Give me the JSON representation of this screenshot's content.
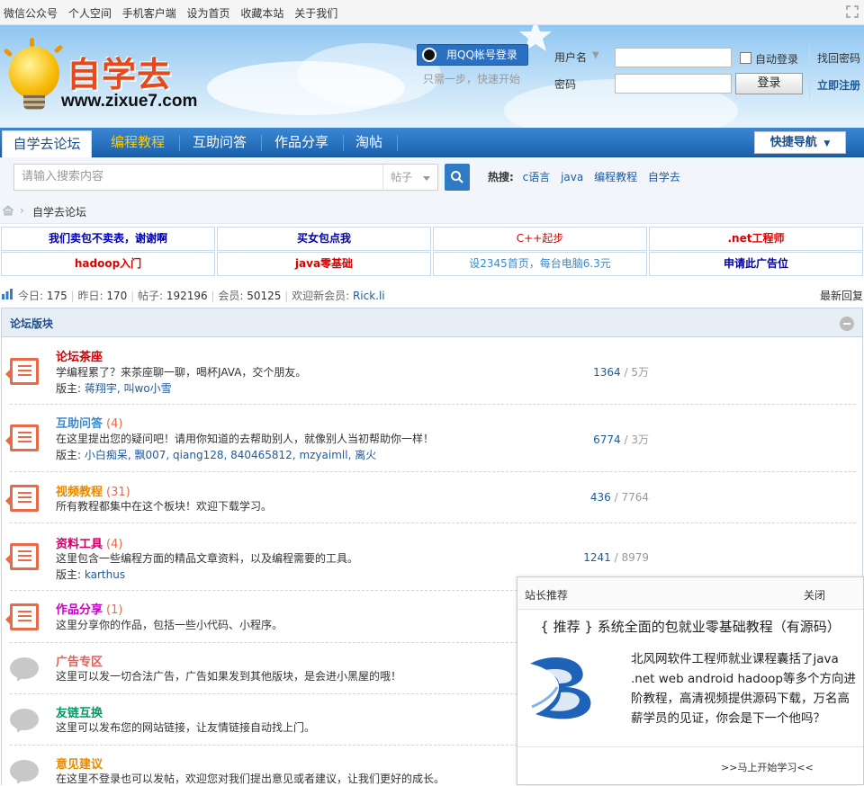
{
  "topbar": {
    "links": [
      "微信公众号",
      "个人空间",
      "手机客户端",
      "设为首页",
      "收藏本站",
      "关于我们"
    ]
  },
  "logo": {
    "name": "自学去",
    "url": "www.zixue7.com"
  },
  "login": {
    "qq_button": "用QQ帐号登录",
    "qq_tip": "只需一步，快速开始",
    "username_label": "用户名",
    "password_label": "密码",
    "auto_login": "自动登录",
    "login_button": "登录",
    "find_password": "找回密码",
    "register": "立即注册"
  },
  "nav": {
    "items": [
      "自学去论坛",
      "编程教程",
      "互助问答",
      "作品分享",
      "淘帖"
    ],
    "quick_nav": "快捷导航"
  },
  "search": {
    "placeholder": "请输入搜索内容",
    "type": "帖子",
    "hot_label": "热搜:",
    "hot_terms": [
      "c语言",
      "java",
      "编程教程",
      "自学去"
    ]
  },
  "breadcrumb": {
    "current": "自学去论坛"
  },
  "ads": [
    {
      "text": "我们卖包不卖表，谢谢啊",
      "color": "#0000aa"
    },
    {
      "text": "买女包点我",
      "color": "#0000aa"
    },
    {
      "text": "C++起步",
      "color": "#dd0000"
    },
    {
      "text": ".net工程师",
      "color": "#dd0000"
    },
    {
      "text": "hadoop入门",
      "color": "#dd0000"
    },
    {
      "text": "java零基础",
      "color": "#dd0000"
    },
    {
      "text": "设2345首页，每台电脑6.3元",
      "color": "#3a8ad0"
    },
    {
      "text": "申请此广告位",
      "color": "#0000aa"
    }
  ],
  "stats": {
    "today_label": "今日:",
    "today": "175",
    "yesterday_label": "昨日:",
    "yesterday": "170",
    "posts_label": "帖子:",
    "posts": "192196",
    "members_label": "会员:",
    "members": "50125",
    "new_member_label": "欢迎新会员:",
    "new_member": "Rick.li",
    "latest_reply": "最新回复"
  },
  "forum": {
    "section_title": "论坛版块",
    "boards": [
      {
        "title": "论坛茶座",
        "count": "",
        "color": "#cc0000",
        "desc": "学编程累了？来茶座聊一聊，喝杯JAVA，交个朋友。",
        "mods_label": "版主:",
        "mods": "蒋翔宇, 叫wo小雪",
        "threads": "1364",
        "posts": "/ 5万",
        "icon": "post-icon"
      },
      {
        "title": "互助问答",
        "count": "(4)",
        "color": "#3a8ad0",
        "desc": "在这里提出您的疑问吧！请用你知道的去帮助别人，就像别人当初帮助你一样！",
        "mods_label": "版主:",
        "mods": "小白痴呆, 飘007, qiang128, 840465812, mzyaimll, 离火",
        "threads": "6774",
        "posts": "/ 3万",
        "icon": "post-icon"
      },
      {
        "title": "视频教程",
        "count": "(31)",
        "color": "#e68a00",
        "desc": "所有教程都集中在这个板块！欢迎下载学习。",
        "mods_label": "",
        "mods": "",
        "threads": "436",
        "posts": "/ 7764",
        "icon": "post-icon"
      },
      {
        "title": "资料工具",
        "count": "(4)",
        "color": "#cc0066",
        "desc": "这里包含一些编程方面的精品文章资料，以及编程需要的工具。",
        "mods_label": "版主:",
        "mods": "karthus",
        "threads": "1241",
        "posts": "/ 8979",
        "icon": "post-icon"
      },
      {
        "title": "作品分享",
        "count": "(1)",
        "color": "#cc00cc",
        "desc": "这里分享你的作品，包括一些小代码、小程序。",
        "mods_label": "",
        "mods": "",
        "threads": "",
        "posts": "",
        "icon": "post-icon"
      },
      {
        "title": "广告专区",
        "count": "",
        "color": "#e06060",
        "desc": "这里可以发一切合法广告，广告如果发到其他版块，是会进小黑屋的哦！",
        "mods_label": "",
        "mods": "",
        "threads": "",
        "posts": "",
        "icon": "bubble-icon"
      },
      {
        "title": "友链互换",
        "count": "",
        "color": "#009966",
        "desc": "这里可以发布您的网站链接，让友情链接自动找上门。",
        "mods_label": "",
        "mods": "",
        "threads": "",
        "posts": "",
        "icon": "bubble-icon"
      },
      {
        "title": "意见建议",
        "count": "",
        "color": "#e68a00",
        "desc": "在这里不登录也可以发帖，欢迎您对我们提出意见或者建议，让我们更好的成长。",
        "mods_label": "",
        "mods": "",
        "threads": "",
        "posts": "",
        "icon": "bubble-icon"
      }
    ]
  },
  "popup": {
    "header": "站长推荐",
    "close": "关闭",
    "title": "{ 推荐 } 系统全面的包就业零基础教程（有源码）",
    "body": "北风网软件工程师就业课程囊括了java .net web android hadoop等多个方向进阶教程，高清视频提供源码下载，万名高薪学员的见证，你会是下一个他吗？",
    "cta": ">>马上开始学习<<"
  }
}
